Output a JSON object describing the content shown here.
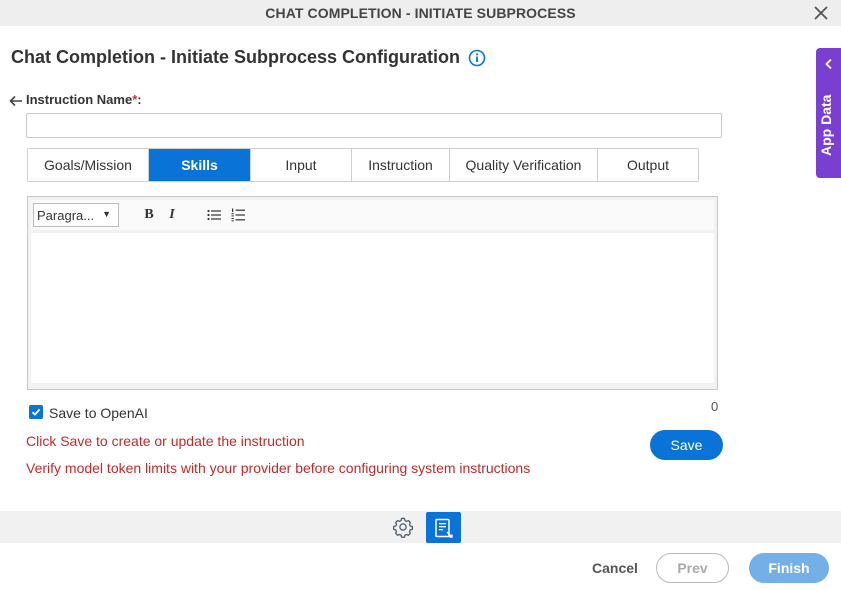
{
  "dialog": {
    "title": "CHAT COMPLETION - INITIATE SUBPROCESS",
    "close_icon": "close-icon"
  },
  "page": {
    "heading": "Chat Completion - Initiate Subprocess Configuration",
    "info_icon": "info-icon"
  },
  "instruction": {
    "back_icon": "arrow-left-icon",
    "label": "Instruction Name",
    "required_mark": "*",
    "colon": ":",
    "value": "",
    "placeholder": ""
  },
  "tabs": [
    {
      "label": "Goals/Mission",
      "active": false
    },
    {
      "label": "Skills",
      "active": true
    },
    {
      "label": "Input",
      "active": false
    },
    {
      "label": "Instruction",
      "active": false
    },
    {
      "label": "Quality Verification",
      "active": false
    },
    {
      "label": "Output",
      "active": false
    }
  ],
  "editor": {
    "format_select": "Paragra...",
    "bold_label": "B",
    "italic_label": "I",
    "bullet_list_icon": "bullet-list-icon",
    "numbered_list_icon": "numbered-list-icon",
    "content": "",
    "char_count": "0"
  },
  "save_to_openai": {
    "label": "Save to OpenAI",
    "checked": true
  },
  "messages": {
    "save_hint": "Click Save to create or update the instruction",
    "token_warning": "Verify model token limits with your provider before configuring system instructions"
  },
  "buttons": {
    "save": "Save",
    "cancel": "Cancel",
    "prev": "Prev",
    "finish": "Finish"
  },
  "bottom_toolbar": {
    "settings_icon": "gear-icon",
    "document_icon": "document-view-icon"
  },
  "side_panel": {
    "label": "App Data",
    "chevron_icon": "chevron-left-icon"
  },
  "colors": {
    "primary": "#0a73d7",
    "error_text": "#c62828",
    "side_panel": "#7a3fd0",
    "finish_disabled": "#74afe8"
  }
}
